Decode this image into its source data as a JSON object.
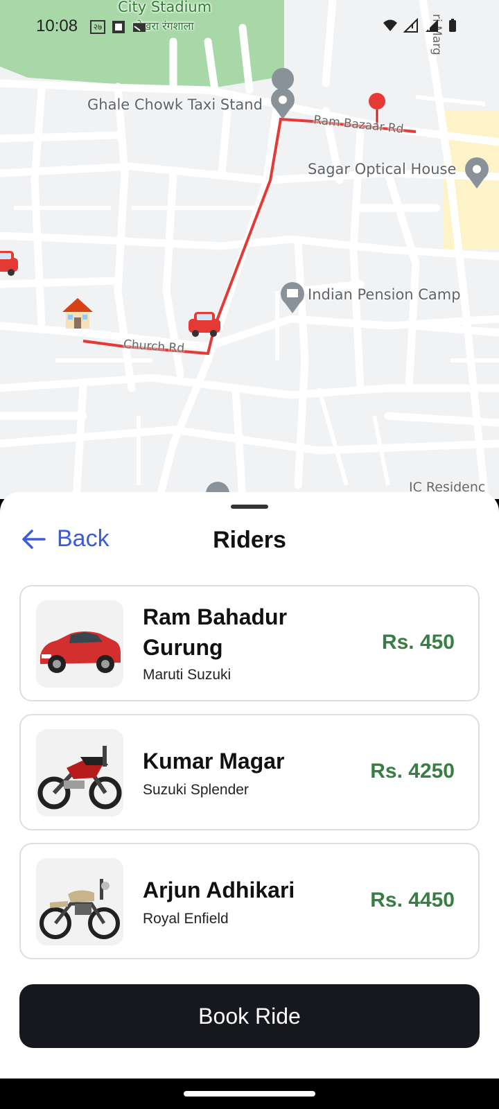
{
  "status_bar": {
    "time": "10:08",
    "left_badge": "२७",
    "icons": [
      "wifi-icon",
      "signal-icon",
      "signal-icon",
      "battery-icon"
    ]
  },
  "map": {
    "labels": {
      "city_stadium": "City Stadium",
      "stadium_np": "पोखरा रंगशाला",
      "taxi_stand": "Ghale Chowk Taxi Stand",
      "ram_bazaar": "Ram Bazaar Rd",
      "sagar": "Sagar Optical House",
      "indian_pension": "Indian Pension Camp",
      "church_rd": "Church Rd",
      "ic_residence": "IC Residenc",
      "marg": "ri Marg"
    },
    "route_color": "#e53935",
    "park_color": "#a8d8a8"
  },
  "sheet": {
    "back_label": "Back",
    "title": "Riders",
    "riders": [
      {
        "name": "Ram Bahadur Gurung",
        "vehicle": "Maruti Suzuki",
        "price": "Rs. 450",
        "image": "red-car"
      },
      {
        "name": "Kumar Magar",
        "vehicle": "Suzuki Splender",
        "price": "Rs. 4250",
        "image": "motorbike-red"
      },
      {
        "name": "Arjun Adhikari",
        "vehicle": "Royal Enfield",
        "price": "Rs. 4450",
        "image": "motorbike-classic"
      }
    ],
    "book_button": "Book Ride"
  },
  "colors": {
    "accent_blue": "#3b5bdb",
    "price_green": "#3a7d44",
    "button_dark": "#16181d"
  }
}
